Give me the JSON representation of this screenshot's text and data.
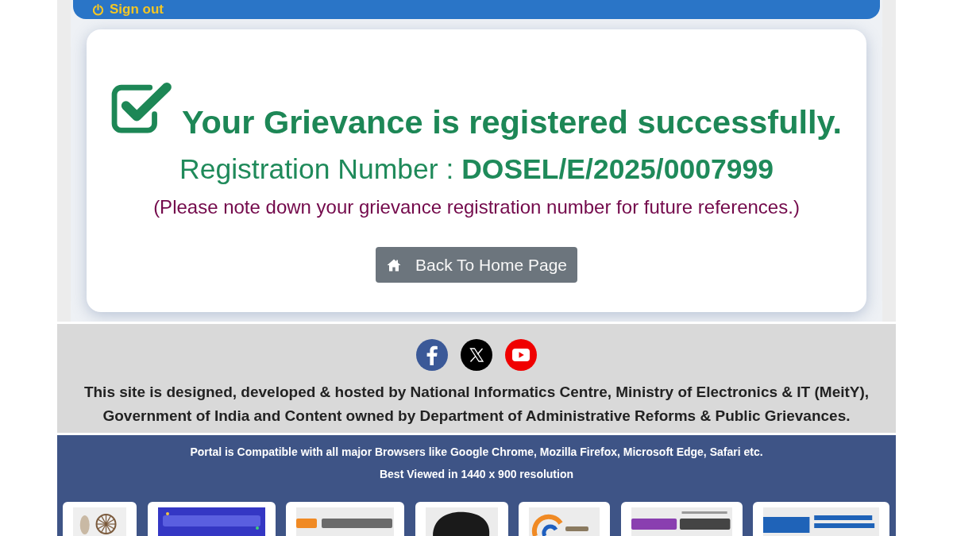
{
  "header": {
    "sign_out": "Sign out"
  },
  "confirmation": {
    "heading": "Your Grievance is registered successfully.",
    "registration": "Registration Number : **DOSEL/E/2025/0007999**",
    "note": "(Please note down your grievance registration number for future references.)",
    "button": "Back To Home Page"
  },
  "footer": {
    "social_links": [
      {
        "kind": "facebook"
      },
      {
        "kind": "x"
      },
      {
        "kind": "youtube"
      }
    ],
    "credit": "This site is designed, developed & hosted by National Informatics Centre, Ministry of Electronics & IT (MeitY), Government of India and Content owned by Department of Administrative Reforms & Public Grievances.",
    "compatibility": "Portal is Compatible with all major Browsers like Google Chrome, Mozilla Firefox, Microsoft Edge, Safari etc.",
    "resolution": "Best Viewed in 1440 x 900 resolution",
    "partner_logos": [
      {
        "kind": "anniversary"
      },
      {
        "kind": "awards"
      },
      {
        "kind": "directory"
      },
      {
        "kind": "lion"
      },
      {
        "kind": "digital"
      },
      {
        "kind": "portal"
      },
      {
        "kind": "nic"
      }
    ]
  }
}
